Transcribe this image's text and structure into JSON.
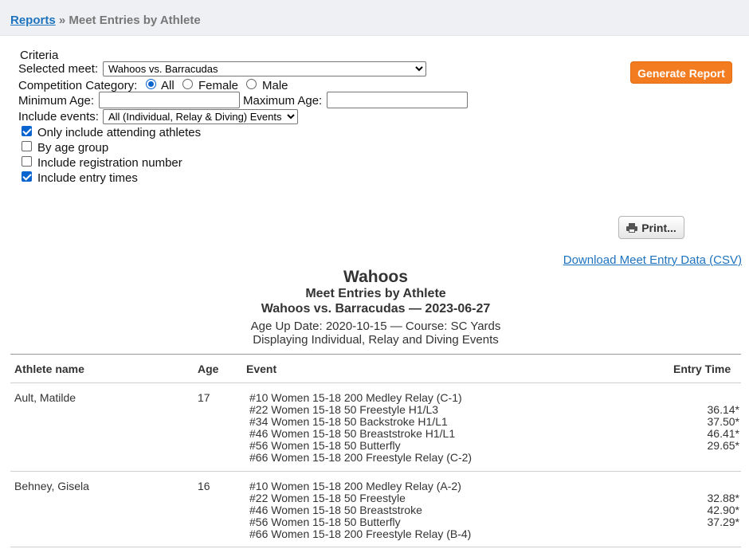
{
  "breadcrumb": {
    "link": "Reports",
    "separator": " » ",
    "current": "Meet Entries by Athlete"
  },
  "criteria": {
    "heading": "Criteria",
    "selected_meet_label": "Selected meet:",
    "selected_meet_value": "Wahoos vs. Barracudas",
    "category_label": "Competition Category:",
    "category_options": [
      "All",
      "Female",
      "Male"
    ],
    "category_selected": "All",
    "min_age_label": "Minimum Age:",
    "min_age_value": "",
    "max_age_label": "Maximum Age:",
    "max_age_value": "",
    "include_events_label": "Include events:",
    "include_events_value": "All (Individual, Relay & Diving) Events",
    "checkboxes": [
      {
        "label": "Only include attending athletes",
        "checked": true
      },
      {
        "label": "By age group",
        "checked": false
      },
      {
        "label": "Include registration number",
        "checked": false
      },
      {
        "label": "Include entry times",
        "checked": true
      }
    ]
  },
  "buttons": {
    "generate": "Generate Report",
    "print": "Print..."
  },
  "csv_link": "Download Meet Entry Data (CSV)",
  "report": {
    "team": "Wahoos",
    "title": "Meet Entries by Athlete",
    "meet_line": "Wahoos vs. Barracudas — 2023-06-27",
    "info_line": "Age Up Date: 2020-10-15 — Course: SC Yards",
    "display_line": "Displaying Individual, Relay and Diving Events",
    "columns": [
      "Athlete name",
      "Age",
      "Event",
      "Entry Time"
    ],
    "athletes": [
      {
        "name": "Ault, Matilde",
        "age": "17",
        "entries": [
          {
            "event": "#10 Women 15-18 200 Medley Relay (C-1)",
            "time": ""
          },
          {
            "event": "#22 Women 15-18 50 Freestyle H1/L3",
            "time": "36.14*"
          },
          {
            "event": "#34 Women 15-18 50 Backstroke H1/L1",
            "time": "37.50*"
          },
          {
            "event": "#46 Women 15-18 50 Breaststroke H1/L1",
            "time": "46.41*"
          },
          {
            "event": "#56 Women 15-18 50 Butterfly",
            "time": "29.65*"
          },
          {
            "event": "#66 Women 15-18 200 Freestyle Relay (C-2)",
            "time": ""
          }
        ]
      },
      {
        "name": "Behney, Gisela",
        "age": "16",
        "entries": [
          {
            "event": "#10 Women 15-18 200 Medley Relay (A-2)",
            "time": ""
          },
          {
            "event": "#22 Women 15-18 50 Freestyle",
            "time": "32.88*"
          },
          {
            "event": "#46 Women 15-18 50 Breaststroke",
            "time": "42.90*"
          },
          {
            "event": "#56 Women 15-18 50 Butterfly",
            "time": "37.29*"
          },
          {
            "event": "#66 Women 15-18 200 Freestyle Relay (B-4)",
            "time": ""
          }
        ]
      }
    ]
  },
  "colors": {
    "accent_orange": "#f47c20",
    "link_blue": "#1e73be",
    "header_bg": "#eef0f3"
  }
}
